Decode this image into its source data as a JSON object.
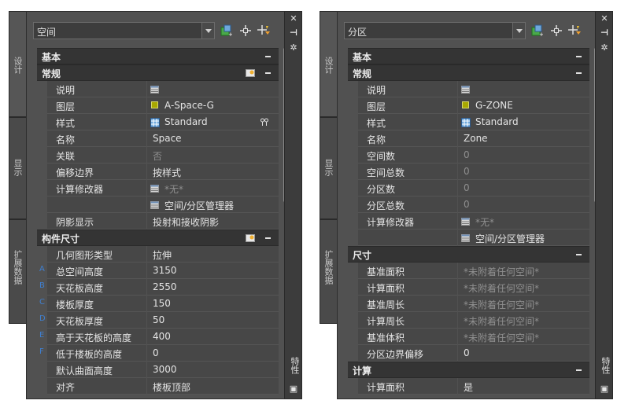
{
  "left": {
    "combo_value": "空间",
    "tabs": [
      "设计",
      "显示",
      "扩展数据"
    ],
    "side_label": "特性",
    "rows": [
      {
        "kind": "cat",
        "label": "基本"
      },
      {
        "kind": "cat",
        "label": "常规",
        "icon": true
      },
      {
        "kind": "prop",
        "name": "说明",
        "value": "",
        "vicon": "table"
      },
      {
        "kind": "prop",
        "name": "图层",
        "value": "A-Space-G",
        "vicon": "layer"
      },
      {
        "kind": "prop",
        "name": "样式",
        "value": "Standard",
        "vicon": "style",
        "link": true
      },
      {
        "kind": "prop",
        "name": "名称",
        "value": "Space"
      },
      {
        "kind": "prop",
        "name": "关联",
        "value": "否",
        "dim": true
      },
      {
        "kind": "prop",
        "name": "偏移边界",
        "value": "按样式"
      },
      {
        "kind": "prop",
        "name": "计算修改器",
        "value": "*无*",
        "vicon": "table",
        "dim": true
      },
      {
        "kind": "prop",
        "name": "",
        "value": "空间/分区管理器",
        "vicon": "table"
      },
      {
        "kind": "prop",
        "name": "阴影显示",
        "value": "投射和接收阴影"
      },
      {
        "kind": "cat",
        "label": "构件尺寸",
        "icon": true
      },
      {
        "kind": "prop",
        "name": "几何图形类型",
        "value": "拉伸"
      },
      {
        "kind": "prop",
        "letter": "A",
        "name": "总空间高度",
        "value": "3150"
      },
      {
        "kind": "prop",
        "letter": "B",
        "name": "天花板高度",
        "value": "2550"
      },
      {
        "kind": "prop",
        "letter": "C",
        "name": "楼板厚度",
        "value": "150"
      },
      {
        "kind": "prop",
        "letter": "D",
        "name": "天花板厚度",
        "value": "50"
      },
      {
        "kind": "prop",
        "letter": "E",
        "name": "高于天花板的高度",
        "value": "400"
      },
      {
        "kind": "prop",
        "letter": "F",
        "name": "低于楼板的高度",
        "value": "0"
      },
      {
        "kind": "prop",
        "name": "默认曲面高度",
        "value": "3000"
      },
      {
        "kind": "prop",
        "name": "对齐",
        "value": "楼板顶部"
      }
    ]
  },
  "right": {
    "combo_value": "分区",
    "tabs": [
      "设计",
      "显示",
      "扩展数据"
    ],
    "side_label": "特性",
    "rows": [
      {
        "kind": "cat",
        "label": "基本"
      },
      {
        "kind": "cat",
        "label": "常规"
      },
      {
        "kind": "prop",
        "name": "说明",
        "value": "",
        "vicon": "table"
      },
      {
        "kind": "prop",
        "name": "图层",
        "value": "G-ZONE",
        "vicon": "layer"
      },
      {
        "kind": "prop",
        "name": "样式",
        "value": "Standard",
        "vicon": "style"
      },
      {
        "kind": "prop",
        "name": "名称",
        "value": "Zone"
      },
      {
        "kind": "prop",
        "name": "空间数",
        "value": "0",
        "dim": true
      },
      {
        "kind": "prop",
        "name": "空间总数",
        "value": "0",
        "dim": true
      },
      {
        "kind": "prop",
        "name": "分区数",
        "value": "0",
        "dim": true
      },
      {
        "kind": "prop",
        "name": "分区总数",
        "value": "0",
        "dim": true
      },
      {
        "kind": "prop",
        "name": "计算修改器",
        "value": "*无*",
        "vicon": "table",
        "dim": true
      },
      {
        "kind": "prop",
        "name": "",
        "value": "空间/分区管理器",
        "vicon": "table"
      },
      {
        "kind": "cat",
        "label": "尺寸"
      },
      {
        "kind": "prop",
        "name": "基准面积",
        "value": "*未附着任何空间*",
        "dim": true
      },
      {
        "kind": "prop",
        "name": "计算面积",
        "value": "*未附着任何空间*",
        "dim": true
      },
      {
        "kind": "prop",
        "name": "基准周长",
        "value": "*未附着任何空间*",
        "dim": true
      },
      {
        "kind": "prop",
        "name": "计算周长",
        "value": "*未附着任何空间*",
        "dim": true
      },
      {
        "kind": "prop",
        "name": "基准体积",
        "value": "*未附着任何空间*",
        "dim": true
      },
      {
        "kind": "prop",
        "name": "分区边界偏移",
        "value": "0"
      },
      {
        "kind": "cat",
        "label": "计算"
      },
      {
        "kind": "prop",
        "name": "计算面积",
        "value": "是"
      }
    ]
  },
  "colors": {
    "panel_bg": "#515151",
    "category_bg": "#343434",
    "row_bg": "#474747",
    "letter": "#3f7fd0",
    "layer_swatch": "#a8a800"
  }
}
